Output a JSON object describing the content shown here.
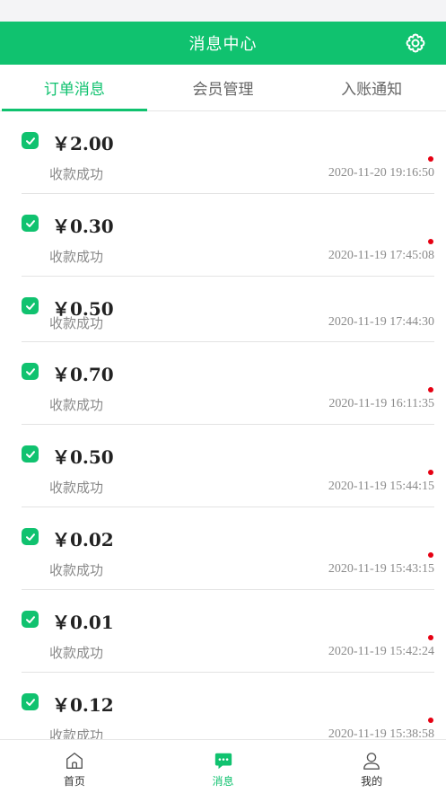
{
  "header": {
    "title": "消息中心"
  },
  "tabs": [
    {
      "label": "订单消息",
      "active": true
    },
    {
      "label": "会员管理",
      "active": false
    },
    {
      "label": "入账通知",
      "active": false
    }
  ],
  "messages": [
    {
      "amount": "￥2.00",
      "status": "收款成功",
      "time": "2020-11-20 19:16:50",
      "unread": true
    },
    {
      "amount": "￥0.30",
      "status": "收款成功",
      "time": "2020-11-19 17:45:08",
      "unread": true
    },
    {
      "amount": "￥0.50",
      "status": "收款成功",
      "time": "2020-11-19 17:44:30",
      "unread": false
    },
    {
      "amount": "￥0.70",
      "status": "收款成功",
      "time": "2020-11-19 16:11:35",
      "unread": true
    },
    {
      "amount": "￥0.50",
      "status": "收款成功",
      "time": "2020-11-19 15:44:15",
      "unread": true
    },
    {
      "amount": "￥0.02",
      "status": "收款成功",
      "time": "2020-11-19 15:43:15",
      "unread": true
    },
    {
      "amount": "￥0.01",
      "status": "收款成功",
      "time": "2020-11-19 15:42:24",
      "unread": true
    },
    {
      "amount": "￥0.12",
      "status": "收款成功",
      "time": "2020-11-19 15:38:58",
      "unread": true
    }
  ],
  "bottom_nav": [
    {
      "label": "首页",
      "icon": "home-icon",
      "active": false
    },
    {
      "label": "消息",
      "icon": "message-icon",
      "active": true
    },
    {
      "label": "我的",
      "icon": "profile-icon",
      "active": false
    }
  ],
  "colors": {
    "accent": "#10c26f",
    "unread_dot": "#e60012"
  }
}
